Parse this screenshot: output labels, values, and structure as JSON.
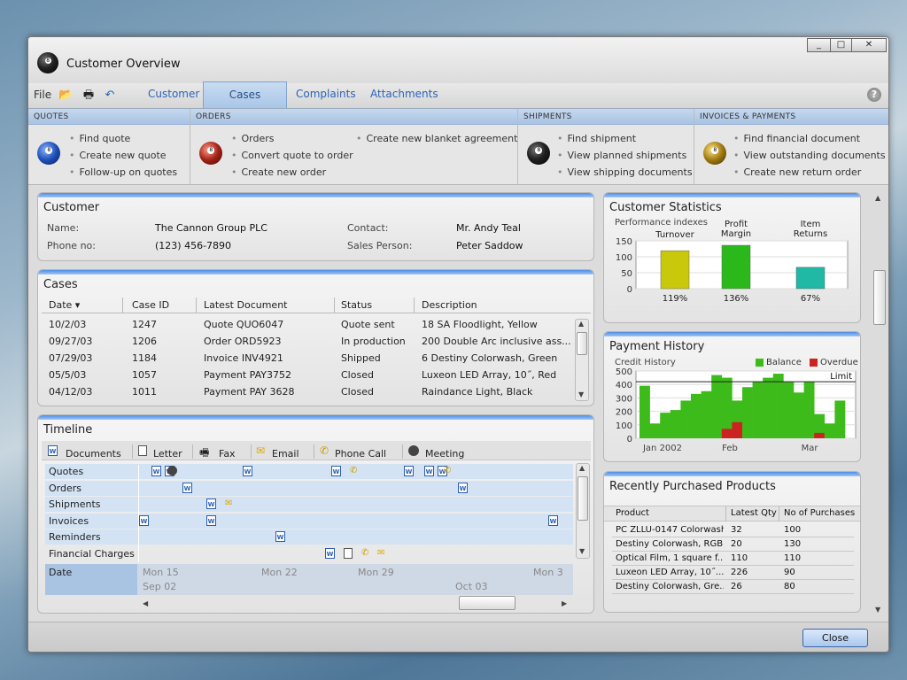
{
  "window": {
    "title": "Customer Overview",
    "controls": [
      "_",
      "□",
      "✕"
    ]
  },
  "menu": {
    "file": "File",
    "tabs": [
      "Customer",
      "Cases",
      "Complaints",
      "Attachments"
    ],
    "active_tab": "Cases",
    "help": "?"
  },
  "ribbon": {
    "quotes": {
      "header": "QUOTES",
      "items": [
        "Find quote",
        "Create new quote",
        "Follow-up on quotes"
      ]
    },
    "orders": {
      "header": "ORDERS",
      "items": [
        "Orders",
        "Convert quote to order",
        "Create new order",
        "Create new blanket agreement"
      ]
    },
    "shipments": {
      "header": "SHIPMENTS",
      "items": [
        "Find shipment",
        "View planned shipments",
        "View shipping documents"
      ]
    },
    "invoices": {
      "header": "INVOICES & PAYMENTS",
      "items": [
        "Find financial document",
        "View outstanding documents",
        "Create new return order"
      ]
    }
  },
  "customer": {
    "title": "Customer",
    "name_label": "Name:",
    "name": "The Cannon Group PLC",
    "phone_label": "Phone no:",
    "phone": "(123) 456-7890",
    "contact_label": "Contact:",
    "contact": "Mr. Andy Teal",
    "sales_label": "Sales Person:",
    "sales": "Peter Saddow"
  },
  "cases": {
    "title": "Cases",
    "columns": [
      "Date",
      "Case ID",
      "Latest Document",
      "Status",
      "Description"
    ],
    "rows": [
      [
        "10/2/03",
        "1247",
        "Quote QUO6047",
        "Quote sent",
        "18 SA Floodlight, Yellow"
      ],
      [
        "09/27/03",
        "1206",
        "Order ORD5923",
        "In production",
        "200 Double Arc inclusive ass..."
      ],
      [
        "07/29/03",
        "1184",
        "Invoice INV4921",
        "Shipped",
        "6 Destiny Colorwash, Green"
      ],
      [
        "05/5/03",
        "1057",
        "Payment PAY3752",
        "Closed",
        "Luxeon LED Array, 10˝, Red"
      ],
      [
        "04/12/03",
        "1011",
        "Payment PAY 3628",
        "Closed",
        "Raindance Light, Black"
      ]
    ]
  },
  "timeline": {
    "title": "Timeline",
    "legend": [
      "Documents",
      "Letter",
      "Fax",
      "Email",
      "Phone Call",
      "Meeting"
    ],
    "rows": [
      "Quotes",
      "Orders",
      "Shipments",
      "Invoices",
      "Reminders",
      "Financial Charges"
    ],
    "date_label": "Date",
    "dates": [
      "Mon 15",
      "Mon 22",
      "Mon 29",
      "Mon 3"
    ],
    "months": [
      "Sep 02",
      "Oct 03"
    ]
  },
  "stats": {
    "title": "Customer Statistics",
    "subtitle": "Performance indexes",
    "chart_data": {
      "type": "bar",
      "categories": [
        "Turnover",
        "Profit Margin",
        "Item Returns"
      ],
      "values": [
        119,
        136,
        67
      ],
      "value_labels": [
        "119%",
        "136%",
        "67%"
      ],
      "yticks": [
        "150",
        "100",
        "50",
        "0"
      ],
      "ylim": [
        0,
        150
      ],
      "colors": [
        "#c9c80a",
        "#2ab81a",
        "#1fb9a6"
      ]
    }
  },
  "payment": {
    "title": "Payment History",
    "subtitle": "Credit History",
    "legend": [
      "Balance",
      "Overdue"
    ],
    "limit_label": "Limit",
    "chart_data": {
      "type": "bar",
      "x_labels": [
        "Jan 2002",
        "Feb",
        "Mar"
      ],
      "yticks": [
        "500",
        "400",
        "300",
        "200",
        "100",
        "0"
      ],
      "ylim": [
        0,
        500
      ],
      "limit": 420,
      "series": [
        {
          "name": "Balance",
          "color": "#3dbb1a",
          "values": [
            390,
            110,
            190,
            210,
            280,
            330,
            350,
            470,
            450,
            280,
            380,
            420,
            450,
            480,
            420,
            340,
            420,
            180,
            110,
            280
          ]
        },
        {
          "name": "Overdue",
          "color": "#cc2222",
          "values": [
            0,
            0,
            0,
            0,
            0,
            0,
            0,
            0,
            70,
            120,
            0,
            0,
            0,
            0,
            0,
            0,
            0,
            40,
            0,
            0
          ]
        }
      ]
    }
  },
  "products": {
    "title": "Recently Purchased Products",
    "columns": [
      "Product",
      "Latest Qty",
      "No of Purchases"
    ],
    "rows": [
      [
        "PC ZLLU-0147 Colorwash...",
        "32",
        "100"
      ],
      [
        "Destiny Colorwash, RGB...",
        "20",
        "130"
      ],
      [
        "Optical Film, 1 square f...",
        "110",
        "110"
      ],
      [
        "Luxeon LED Array, 10˝...",
        "226",
        "90"
      ],
      [
        "Destiny Colorwash, Gre...",
        "26",
        "80"
      ]
    ]
  },
  "footer": {
    "close": "Close"
  }
}
